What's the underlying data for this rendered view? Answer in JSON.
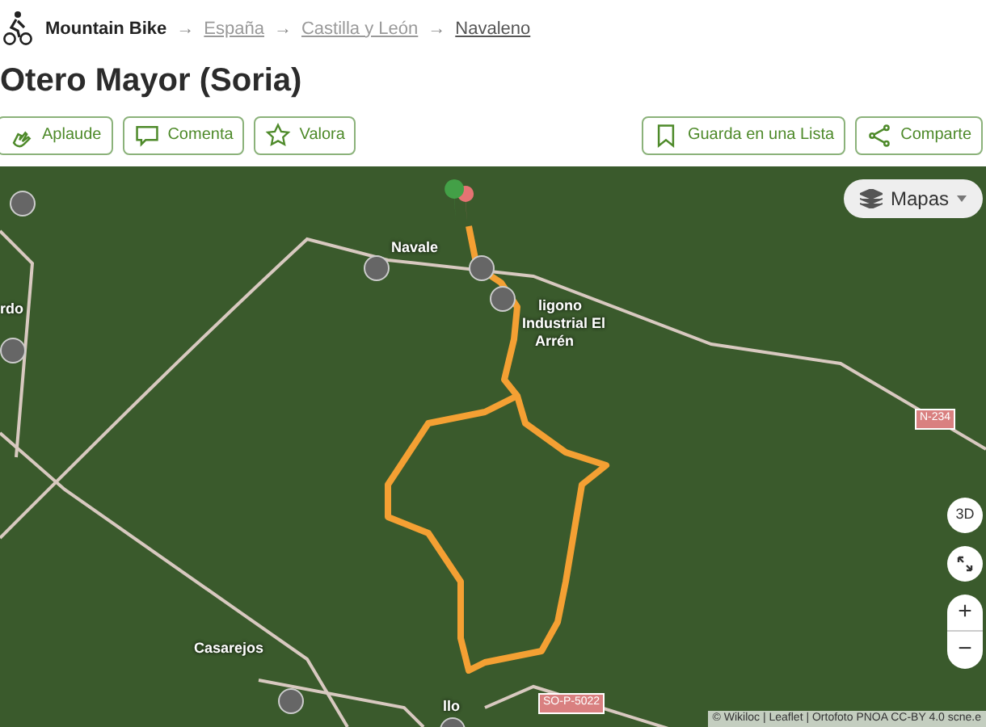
{
  "breadcrumb": {
    "activity": "Mountain Bike",
    "links": [
      {
        "separator": "→",
        "label": "España"
      },
      {
        "separator": "→",
        "label": "Castilla y León"
      },
      {
        "separator": "→",
        "label": "Navaleno"
      }
    ]
  },
  "title": "Otero Mayor (Soria)",
  "actions_left": [
    {
      "kind": "clap",
      "label": "Aplaude"
    },
    {
      "kind": "comment",
      "label": "Comenta"
    },
    {
      "kind": "star",
      "label": "Valora"
    }
  ],
  "actions_right": [
    {
      "kind": "bookmark",
      "label": "Guarda en una Lista"
    },
    {
      "kind": "share",
      "label": "Comparte"
    }
  ],
  "map": {
    "layers_button": "Mapas",
    "view_3d": "3D",
    "zoom_in": "+",
    "zoom_out": "−",
    "place_labels": [
      "Navale",
      "ligono",
      "Industrial El",
      "Arrén",
      "rdo",
      "Casarejos",
      "llo"
    ],
    "road_labels": [
      "N-234",
      "SO-P-5022"
    ],
    "attribution": "© Wikiloc | Leaflet | Ortofoto PNOA CC-BY 4.0 scne.e"
  }
}
